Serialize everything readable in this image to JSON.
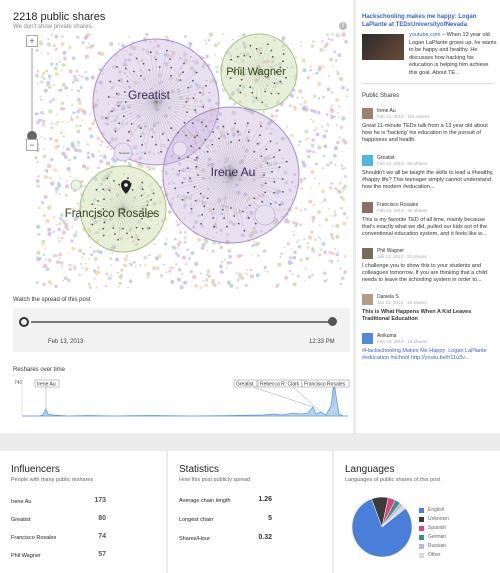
{
  "header": {
    "title": "2218 public shares",
    "subtitle": "We don't show private shares."
  },
  "graph": {
    "clusters": [
      {
        "name": "Greatist",
        "color": "#cdb9e0"
      },
      {
        "name": "Phil Wagner",
        "color": "#cfe0b4"
      },
      {
        "name": "Irene Au",
        "color": "#cdb9e0"
      },
      {
        "name": "Francisco Rosales",
        "color": "#cfe0b4"
      }
    ],
    "small_labels": [
      "Network",
      "DK"
    ],
    "dot_colors": [
      "#c9b3df",
      "#bfd9a6",
      "#a9c6ea",
      "#e6b5cf",
      "#f2d39b",
      "#cfcfcf"
    ]
  },
  "spread": {
    "label": "Watch the spread of this post",
    "start_date": "Feb 13, 2013",
    "end_time": "12:33 PM"
  },
  "reshares": {
    "label": "Reshares over time",
    "y_max_label": "740",
    "annotations": [
      "Irene Au",
      "Greatist",
      "Rebecca R. Clark",
      "Francisco Rosales"
    ]
  },
  "post": {
    "headline": "Hackschooling makes me happy: Logan LaPlante at TEDxUniversityofNevada",
    "link_text": "youtube.com",
    "description": " – When 13 year old Logan LaPlante grows up, he wants to be happy and healthy. He discusses how hacking his education is helping him achieve this goal. About TE..."
  },
  "public_shares": {
    "title": "Public Shares",
    "items": [
      {
        "name": "Irene Au",
        "meta": "Feb 13, 2013 · 161 shares",
        "text": "Great 11-minute TEDx talk from a 13 year old about how he is 'hacking' his education in the pursuit of happiness and health.",
        "style": "plain",
        "avatar": "#a0806b"
      },
      {
        "name": "Greatist",
        "meta": "Feb 13, 2013 · 66 shares",
        "text": "Shouldn't we all be taught the skills to lead a #healthy, #happy life? This teenager simply cannot understand how the modern #education...",
        "style": "plain",
        "avatar": "#4cb6e6"
      },
      {
        "name": "Francisco Rosales",
        "meta": "Feb 13, 2013 · 30 shares",
        "text": "This is my favorite TED of all time, mainly because that's exactly what we did, pulled our kids out of the conventional education system, and it feels like w...",
        "style": "plain",
        "avatar": "#8d6e63"
      },
      {
        "name": "Phil Wagner",
        "meta": "Jan 13, 2013 · 22 shares",
        "text": "I challenge you to show this to your students and colleagues tomorrow. If you are thinking that a child needs to leave the schooling system in order to...",
        "style": "plain",
        "avatar": "#7a6a5a"
      },
      {
        "name": "Daniela S",
        "meta": "Jan 13, 2013 · 18 shares",
        "text": "This is What Happens When A Kid Leaves Traditional Education",
        "style": "bold",
        "avatar": "#b59c88"
      },
      {
        "name": "Anikuma",
        "meta": "Feb 13, 2013 · 16 shares",
        "text": "#Hackschooling Makes Me Happy: Logan LaPlante #education #school http://youtu.be/h11u3v...",
        "style": "blue",
        "avatar": "#4f8ad6"
      }
    ]
  },
  "influencers": {
    "title": "Influencers",
    "subtitle": "People with many public reshares",
    "rows": [
      {
        "name": "Irene Au",
        "value": "173"
      },
      {
        "name": "Greatist",
        "value": "80"
      },
      {
        "name": "Francisco Rosales",
        "value": "74"
      },
      {
        "name": "Phil Wagner",
        "value": "57"
      }
    ]
  },
  "statistics": {
    "title": "Statistics",
    "subtitle": "How this post publicly spread",
    "rows": [
      {
        "name": "Average chain length",
        "value": "1.26"
      },
      {
        "name": "Longest chain",
        "value": "5"
      },
      {
        "name": "Shares/Hour",
        "value": "0.32"
      }
    ]
  },
  "languages": {
    "title": "Languages",
    "subtitle": "Languages of public shares of this post",
    "chart_data": {
      "type": "pie",
      "categories": [
        "English",
        "Unknown",
        "Spanish",
        "German",
        "Russian",
        "Other"
      ],
      "values": [
        80,
        9,
        4,
        3,
        2,
        2
      ],
      "colors": [
        "#4a7fd9",
        "#3b3b3b",
        "#d9477a",
        "#3b8f8f",
        "#b8b8d8",
        "#dadada"
      ]
    }
  }
}
